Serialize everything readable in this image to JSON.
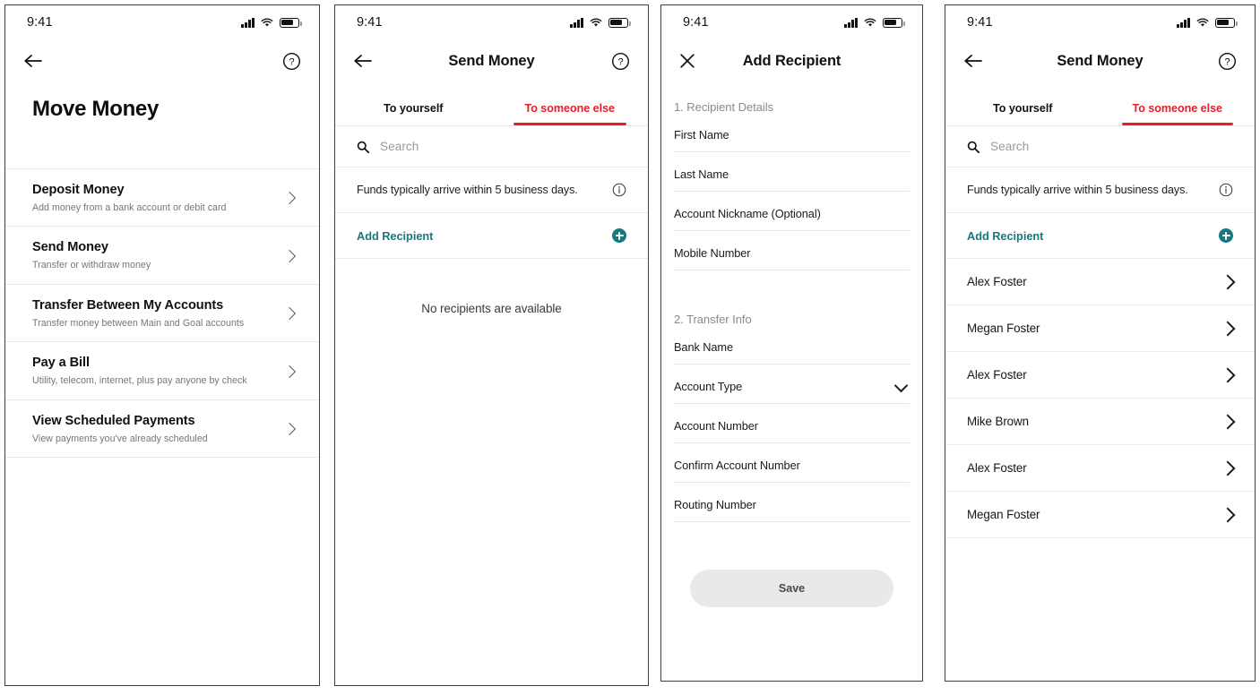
{
  "colors": {
    "accent_red": "#ec1c24",
    "accent_teal": "#17797e",
    "text_primary": "#111111",
    "text_muted": "#757575",
    "divider": "#e8e8e8",
    "save_button_bg": "#e9e9e9"
  },
  "status_bar": {
    "time": "9:41",
    "signal_icon": "cellular-signal-icon",
    "wifi_icon": "wifi-icon",
    "battery_icon": "battery-icon"
  },
  "screens": [
    {
      "id": "move-money",
      "nav": {
        "left_icon": "back-arrow-icon",
        "title": "",
        "right_icon": "help-circle-icon"
      },
      "page_title": "Move Money",
      "menu_items": [
        {
          "title": "Deposit Money",
          "subtitle": "Add money from a bank account or debit card",
          "chevron": "chevron-right-icon"
        },
        {
          "title": "Send Money",
          "subtitle": "Transfer or withdraw  money",
          "chevron": "chevron-right-icon"
        },
        {
          "title": "Transfer Between My Accounts",
          "subtitle": "Transfer money between Main and Goal accounts",
          "chevron": "chevron-right-icon"
        },
        {
          "title": "Pay a Bill",
          "subtitle": "Utility, telecom, internet,  plus pay anyone by check",
          "chevron": "chevron-right-icon"
        },
        {
          "title": "View Scheduled Payments",
          "subtitle": "View payments you've already scheduled",
          "chevron": "chevron-right-icon"
        }
      ]
    },
    {
      "id": "send-money-empty",
      "nav": {
        "left_icon": "back-arrow-icon",
        "title": "Send Money",
        "right_icon": "help-circle-icon"
      },
      "tabs": [
        {
          "label": "To yourself",
          "active": false
        },
        {
          "label": "To someone else",
          "active": true
        }
      ],
      "search": {
        "placeholder": "Search",
        "icon": "search-icon"
      },
      "info_banner": {
        "text": "Funds typically arrive within 5 business days.",
        "icon": "info-circle-icon"
      },
      "add_recipient": {
        "label": "Add Recipient",
        "icon": "plus-circle-icon"
      },
      "empty_state": "No recipients are available"
    },
    {
      "id": "add-recipient",
      "nav": {
        "left_icon": "close-x-icon",
        "title": "Add Recipient",
        "right_icon": ""
      },
      "sections": [
        {
          "heading": "1. Recipient Details",
          "fields": [
            {
              "label": "First Name",
              "type": "text"
            },
            {
              "label": "Last Name",
              "type": "text"
            },
            {
              "label": "Account Nickname (Optional)",
              "type": "text"
            },
            {
              "label": "Mobile Number",
              "type": "text"
            }
          ]
        },
        {
          "heading": "2. Transfer Info",
          "fields": [
            {
              "label": "Bank Name",
              "type": "text"
            },
            {
              "label": "Account Type",
              "type": "select",
              "icon": "chevron-down-icon"
            },
            {
              "label": "Account Number",
              "type": "text"
            },
            {
              "label": "Confirm Account Number",
              "type": "text"
            },
            {
              "label": "Routing Number",
              "type": "text"
            }
          ]
        }
      ],
      "save_button": "Save"
    },
    {
      "id": "send-money-list",
      "nav": {
        "left_icon": "back-arrow-icon",
        "title": "Send Money",
        "right_icon": "help-circle-icon"
      },
      "tabs": [
        {
          "label": "To yourself",
          "active": false
        },
        {
          "label": "To someone else",
          "active": true
        }
      ],
      "search": {
        "placeholder": "Search",
        "icon": "search-icon"
      },
      "info_banner": {
        "text": "Funds typically arrive within 5 business days.",
        "icon": "info-circle-icon"
      },
      "add_recipient": {
        "label": "Add Recipient",
        "icon": "plus-circle-icon"
      },
      "recipients": [
        {
          "name": "Alex Foster",
          "chevron": "chevron-right-icon"
        },
        {
          "name": "Megan Foster",
          "chevron": "chevron-right-icon"
        },
        {
          "name": "Alex Foster",
          "chevron": "chevron-right-icon"
        },
        {
          "name": "Mike Brown",
          "chevron": "chevron-right-icon"
        },
        {
          "name": "Alex Foster",
          "chevron": "chevron-right-icon"
        },
        {
          "name": "Megan Foster",
          "chevron": "chevron-right-icon"
        }
      ]
    }
  ]
}
